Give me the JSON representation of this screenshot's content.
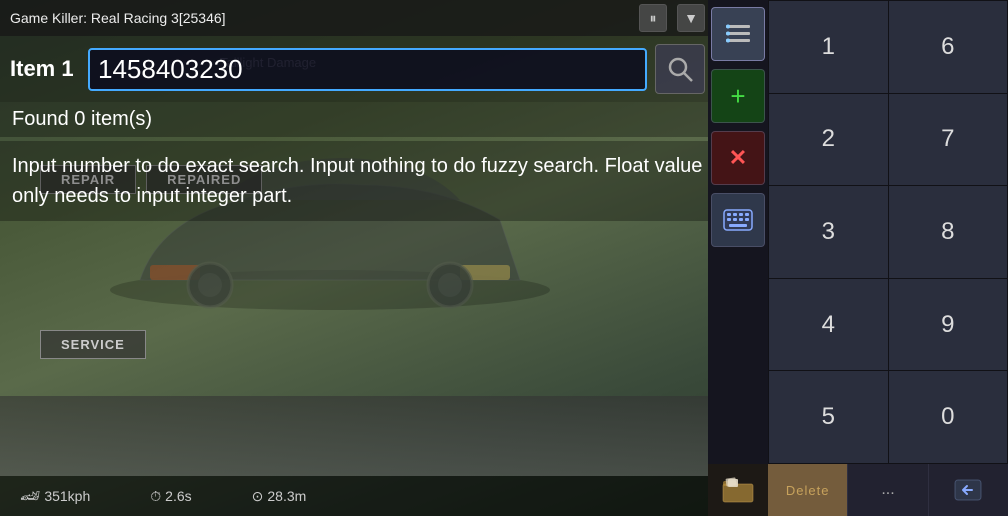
{
  "title": {
    "text": "Game Killer: Real Racing 3[25346]",
    "pause_label": "⏸",
    "menu_label": "▼"
  },
  "search": {
    "item_label": "Item 1",
    "input_value": "1458403230",
    "search_icon": "🔍"
  },
  "found": {
    "text": "Found 0 item(s)"
  },
  "buttons": {
    "repair": "REPAIR",
    "repaired": "REPAIRED",
    "service": "SERVICE"
  },
  "info": {
    "text": "Input number to do exact search. Input nothing to do fuzzy search. Float value only needs to input integer part."
  },
  "status_bar": {
    "speed": "351kph",
    "time": "2.6s",
    "distance": "28.3m"
  },
  "taillight": {
    "label": "Taillight Damage"
  },
  "sidebar": {
    "icons": {
      "list": "☰",
      "plus": "+",
      "cross": "✕",
      "keyboard": "⌨"
    },
    "numpad": [
      {
        "label": "1",
        "row": 1,
        "col": 1
      },
      {
        "label": "6",
        "row": 1,
        "col": 2
      },
      {
        "label": "2",
        "row": 2,
        "col": 1
      },
      {
        "label": "7",
        "row": 2,
        "col": 2
      },
      {
        "label": "3",
        "row": 3,
        "col": 1
      },
      {
        "label": "8",
        "row": 3,
        "col": 2
      },
      {
        "label": "4",
        "row": 4,
        "col": 1
      },
      {
        "label": "9",
        "row": 4,
        "col": 2
      },
      {
        "label": "5",
        "row": 5,
        "col": 1
      },
      {
        "label": "0",
        "row": 5,
        "col": 2
      }
    ],
    "bottom": {
      "delete_label": "Delete",
      "ellipsis": "...",
      "back_icon": "⬅"
    }
  }
}
